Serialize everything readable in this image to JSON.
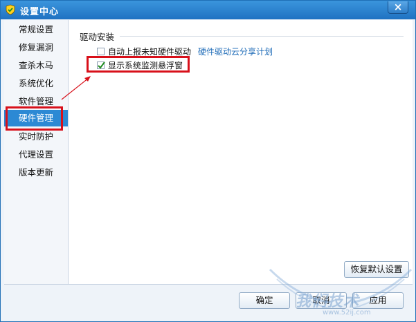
{
  "window": {
    "title": "设置中心",
    "close_label": "×"
  },
  "sidebar": {
    "items": [
      {
        "label": "常规设置",
        "active": false
      },
      {
        "label": "修复漏洞",
        "active": false
      },
      {
        "label": "查杀木马",
        "active": false
      },
      {
        "label": "系统优化",
        "active": false
      },
      {
        "label": "软件管理",
        "active": false
      },
      {
        "label": "硬件管理",
        "active": true
      },
      {
        "label": "实时防护",
        "active": false
      },
      {
        "label": "代理设置",
        "active": false
      },
      {
        "label": "版本更新",
        "active": false
      }
    ]
  },
  "main": {
    "section_title": "驱动安装",
    "options": [
      {
        "label": "自动上报未知硬件驱动",
        "checked": false,
        "link": "硬件驱动云分享计划"
      },
      {
        "label": "显示系统监测悬浮窗",
        "checked": true
      }
    ],
    "restore_label": "恢复默认设置"
  },
  "footer": {
    "ok_label": "确定",
    "cancel_label": "取消",
    "apply_label": "应用"
  },
  "watermark": {
    "text": "我们技术",
    "sub": "www.52ij.com"
  },
  "colors": {
    "title_bar": "#2a82d0",
    "active_item": "#2c89d4",
    "link": "#1c6ab7",
    "highlight": "#d8101a"
  }
}
